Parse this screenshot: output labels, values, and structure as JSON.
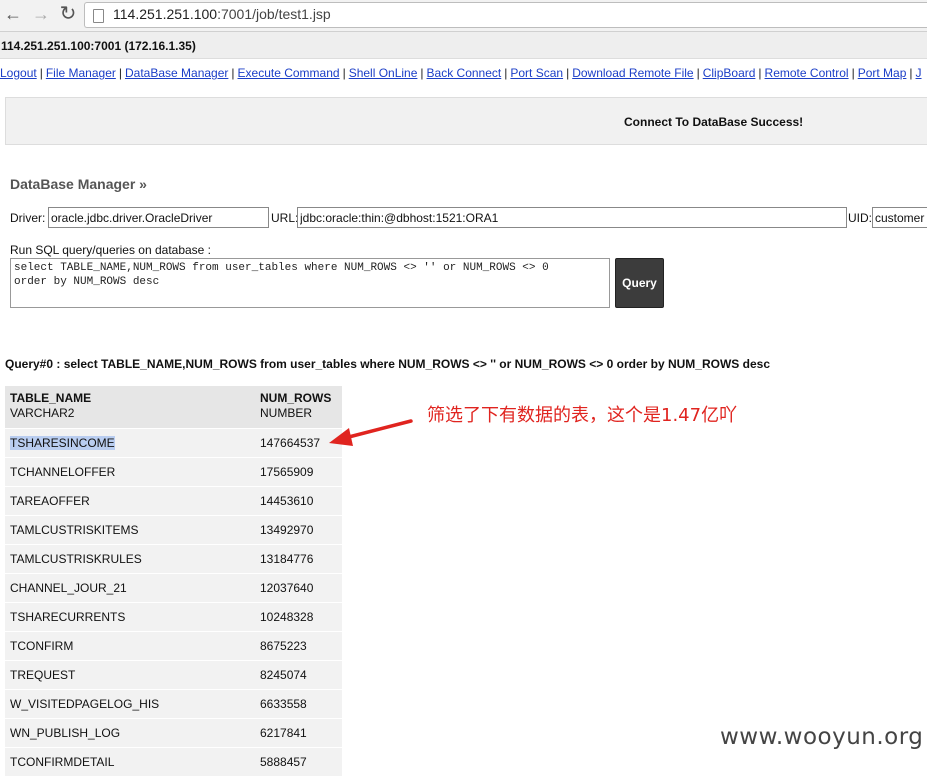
{
  "browser": {
    "url_host": "114.251.251.100",
    "url_path": ":7001/job/test1.jsp"
  },
  "host_line": "114.251.251.100:7001 (172.16.1.35)",
  "nav_links": [
    "Logout",
    "File Manager",
    "DataBase Manager",
    "Execute Command",
    "Shell OnLine",
    "Back Connect",
    "Port Scan",
    "Download Remote File",
    "ClipBoard",
    "Remote Control",
    "Port Map",
    "J"
  ],
  "message": "Connect To DataBase Success!",
  "section_title": "DataBase Manager »",
  "form": {
    "driver_label": "Driver:",
    "driver_value": "oracle.jdbc.driver.OracleDriver",
    "url_label": "URL:",
    "url_value": "jdbc:oracle:thin:@dbhost:1521:ORA1",
    "uid_label": "UID:",
    "uid_value": "customer",
    "sql_label": "Run SQL query/queries on database :",
    "sql_value": "select TABLE_NAME,NUM_ROWS from user_tables where NUM_ROWS <> '' or NUM_ROWS <> 0\norder by NUM_ROWS desc",
    "query_button": "Query"
  },
  "query_title": "Query#0 : select TABLE_NAME,NUM_ROWS from user_tables where NUM_ROWS <> '' or NUM_ROWS <> 0 order by NUM_ROWS desc",
  "table": {
    "col1_name": "TABLE_NAME",
    "col1_type": "VARCHAR2",
    "col2_name": "NUM_ROWS",
    "col2_type": "NUMBER",
    "rows": [
      {
        "name": "TSHARESINCOME",
        "rows": "147664537"
      },
      {
        "name": "TCHANNELOFFER",
        "rows": "17565909"
      },
      {
        "name": "TAREAOFFER",
        "rows": "14453610"
      },
      {
        "name": "TAMLCUSTRISKITEMS",
        "rows": "13492970"
      },
      {
        "name": "TAMLCUSTRISKRULES",
        "rows": "13184776"
      },
      {
        "name": "CHANNEL_JOUR_21",
        "rows": "12037640"
      },
      {
        "name": "TSHARECURRENTS",
        "rows": "10248328"
      },
      {
        "name": "TCONFIRM",
        "rows": "8675223"
      },
      {
        "name": "TREQUEST",
        "rows": "8245074"
      },
      {
        "name": "W_VISITEDPAGELOG_HIS",
        "rows": "6633558"
      },
      {
        "name": "WN_PUBLISH_LOG",
        "rows": "6217841"
      },
      {
        "name": "TCONFIRMDETAIL",
        "rows": "5888457"
      }
    ]
  },
  "annotation": "筛选了下有数据的表，这个是1.47亿吖",
  "watermark": "www.wooyun.org",
  "colors": {
    "link": "#1b3ec7",
    "annotation": "#e0241f",
    "query_button": "#3c3c3c",
    "highlight": "#b9cdf0"
  },
  "icons": [
    "back-arrow-icon",
    "forward-arrow-icon",
    "reload-icon",
    "page-icon"
  ]
}
